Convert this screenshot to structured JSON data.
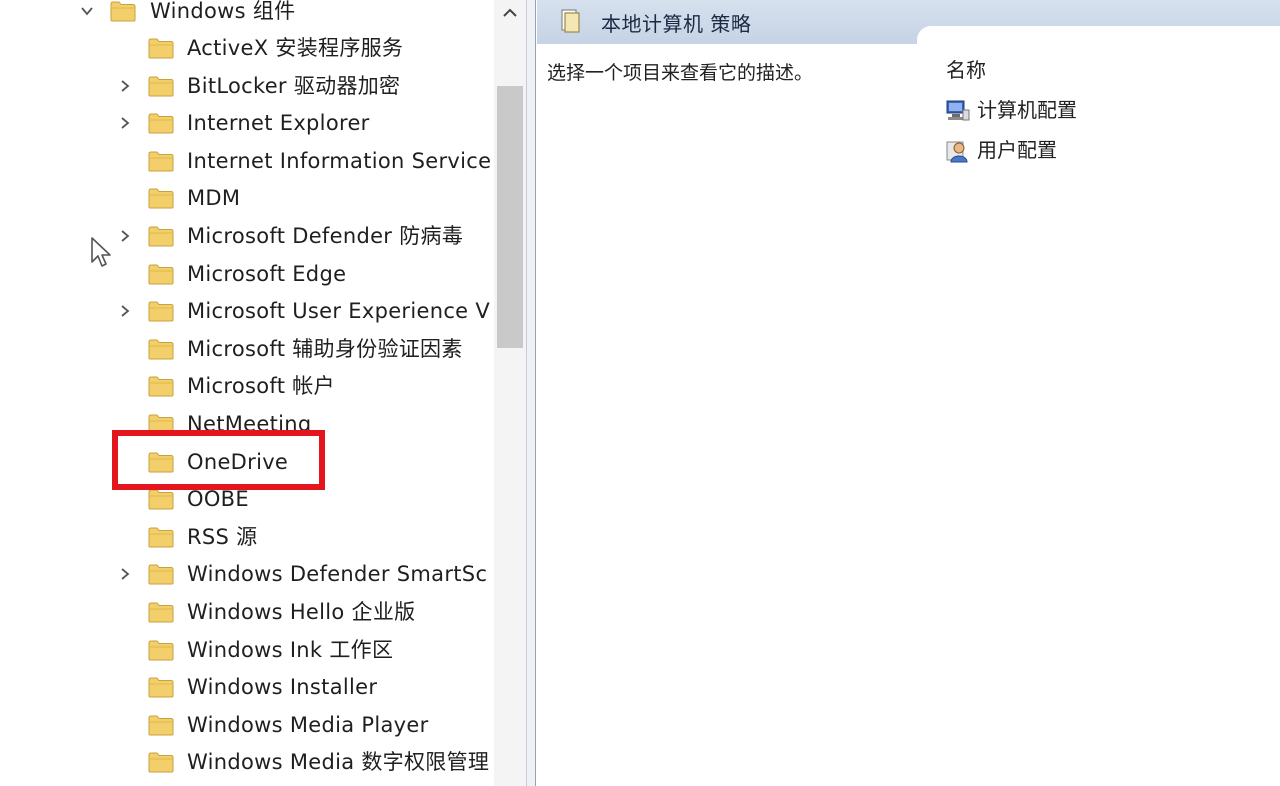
{
  "tree": {
    "root": {
      "label": "Windows 组件",
      "expanded": true
    },
    "items": [
      {
        "label": "ActiveX 安装程序服务",
        "expandable": false
      },
      {
        "label": "BitLocker 驱动器加密",
        "expandable": true
      },
      {
        "label": "Internet Explorer",
        "expandable": true
      },
      {
        "label": "Internet Information Service",
        "expandable": false
      },
      {
        "label": "MDM",
        "expandable": false
      },
      {
        "label": "Microsoft Defender 防病毒",
        "expandable": true
      },
      {
        "label": "Microsoft Edge",
        "expandable": false
      },
      {
        "label": "Microsoft User Experience V",
        "expandable": true
      },
      {
        "label": "Microsoft 辅助身份验证因素",
        "expandable": false
      },
      {
        "label": "Microsoft 帐户",
        "expandable": false
      },
      {
        "label": "NetMeeting",
        "expandable": false
      },
      {
        "label": "OneDrive",
        "expandable": false,
        "highlighted": true
      },
      {
        "label": "OOBE",
        "expandable": false
      },
      {
        "label": "RSS 源",
        "expandable": false
      },
      {
        "label": "Windows Defender SmartSc",
        "expandable": true
      },
      {
        "label": "Windows Hello 企业版",
        "expandable": false
      },
      {
        "label": "Windows Ink 工作区",
        "expandable": false
      },
      {
        "label": "Windows Installer",
        "expandable": false
      },
      {
        "label": "Windows Media Player",
        "expandable": false
      },
      {
        "label": "Windows Media 数字权限管理",
        "expandable": false
      }
    ]
  },
  "right": {
    "title": "本地计算机 策略",
    "description": "选择一个项目来查看它的描述。",
    "column_header": "名称",
    "entries": [
      {
        "label": "计算机配置",
        "icon": "computer-config-icon"
      },
      {
        "label": "用户配置",
        "icon": "user-config-icon"
      }
    ]
  },
  "colors": {
    "highlight": "#e3161e",
    "folder": "#f2cf6b",
    "header_band": "#c9d6e7"
  }
}
